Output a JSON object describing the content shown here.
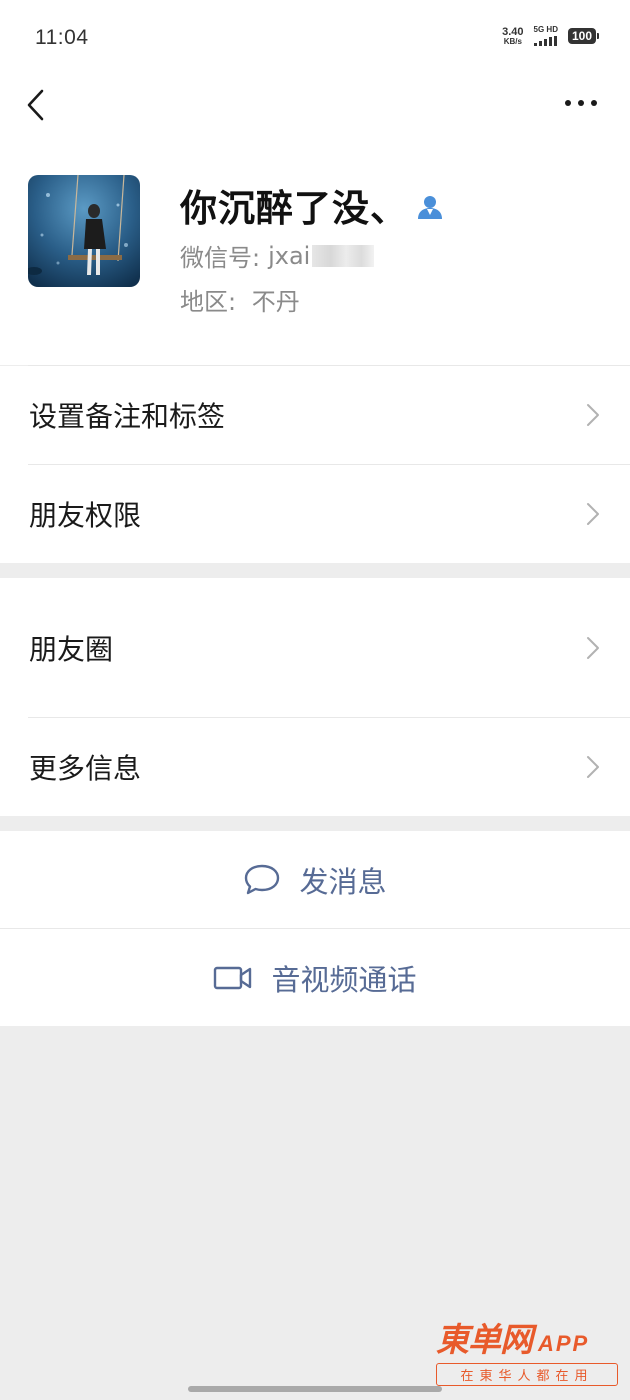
{
  "status_bar": {
    "time": "11:04",
    "net_speed_value": "3.40",
    "net_speed_unit": "KB/s",
    "signal_label": "5G HD",
    "battery": "100"
  },
  "nav": {
    "back_icon": "chevron-left-icon",
    "more_icon": "more-horizontal-icon"
  },
  "profile": {
    "name": "你沉醉了没、",
    "wechat_id_label": "微信号:",
    "wechat_id_value": "jxai",
    "region_label": "地区:",
    "region_value": "不丹",
    "badge_icon": "person-icon"
  },
  "settings": {
    "items": [
      {
        "label": "设置备注和标签"
      },
      {
        "label": "朋友权限"
      }
    ]
  },
  "social": {
    "items": [
      {
        "label": "朋友圈"
      },
      {
        "label": "更多信息"
      }
    ]
  },
  "actions": {
    "message_label": "发消息",
    "video_call_label": "音视频通话",
    "message_icon": "chat-bubble-icon",
    "video_icon": "video-camera-icon"
  },
  "watermark": {
    "brand": "東单网",
    "app": "APP",
    "slogan": "在東华人都在用"
  },
  "colors": {
    "accent_link": "#576b95",
    "badge_blue": "#4a8fd9",
    "watermark_orange": "#e85a2b",
    "background": "#ededed"
  }
}
